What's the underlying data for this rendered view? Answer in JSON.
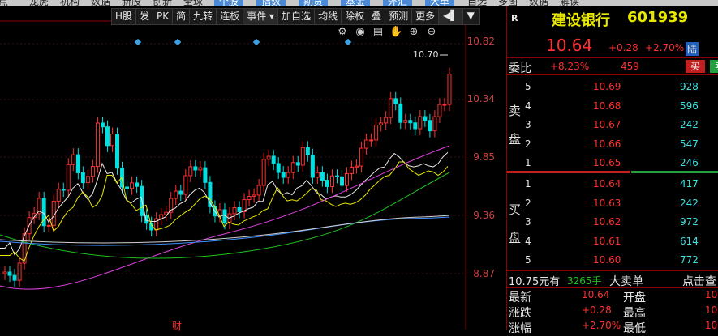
{
  "top_menu": [
    {
      "label": "点"
    },
    {
      "label": "龙虎"
    },
    {
      "label": "机构"
    },
    {
      "label": "数据"
    },
    {
      "label": "新股"
    },
    {
      "label": "创新"
    },
    {
      "label": "全球"
    },
    {
      "label": "个股",
      "highlight": true
    },
    {
      "label": "指数",
      "highlight": true
    },
    {
      "label": "期货",
      "highlight": true
    },
    {
      "label": "基金",
      "highlight": true
    },
    {
      "label": "外汇",
      "highlight": true
    },
    {
      "label": "大单",
      "highlight": true
    },
    {
      "label": "自选"
    },
    {
      "label": "多图"
    },
    {
      "label": "数据"
    },
    {
      "label": "解读"
    }
  ],
  "toolbar": [
    "H股",
    "发",
    "PK",
    "简",
    "九转",
    "连板",
    "事件 ▾",
    "加自选",
    "均线",
    "除权",
    "叠",
    "预测",
    "更多",
    "◀▌",
    "▼"
  ],
  "chart_icons": [
    "settings-icon",
    "eye-icon",
    "layers-icon",
    "hand-icon",
    "zoom-in-icon",
    "zoom-out-icon"
  ],
  "price_axis": [
    "10.82",
    "10.34",
    "9.85",
    "9.36",
    "8.87"
  ],
  "high_marker": "10.70",
  "bottom_marker": "财",
  "quote": {
    "label": "R",
    "name": "建设银行",
    "code": "601939",
    "price": "10.64",
    "change": "+0.28",
    "pct": "+2.70%",
    "market": "陆"
  },
  "weibi": {
    "label": "委比",
    "pct": "+8.23%",
    "value": "459",
    "sell_btn": "买",
    "buy_btn": "卖"
  },
  "sell_label": [
    "卖",
    "盘"
  ],
  "buy_label": [
    "买",
    "盘"
  ],
  "sell_levels": [
    {
      "level": "5",
      "price": "10.69",
      "vol": "928"
    },
    {
      "level": "4",
      "price": "10.68",
      "vol": "596"
    },
    {
      "level": "3",
      "price": "10.67",
      "vol": "242"
    },
    {
      "level": "2",
      "price": "10.66",
      "vol": "547"
    },
    {
      "level": "1",
      "price": "10.65",
      "vol": "246"
    }
  ],
  "buy_levels": [
    {
      "level": "1",
      "price": "10.64",
      "vol": "417"
    },
    {
      "level": "2",
      "price": "10.63",
      "vol": "242"
    },
    {
      "level": "3",
      "price": "10.62",
      "vol": "972"
    },
    {
      "level": "4",
      "price": "10.61",
      "vol": "614"
    },
    {
      "level": "5",
      "price": "10.60",
      "vol": "772"
    }
  ],
  "big_order": {
    "amount": "10.75元有",
    "vol": "3265手",
    "label": "大卖单",
    "action": "点击查"
  },
  "stats": [
    {
      "k1": "最新",
      "v1": "10.64",
      "k2": "开盘",
      "v2": "10"
    },
    {
      "k1": "涨跌",
      "v1": "+0.28",
      "k2": "最高",
      "v2": "10"
    },
    {
      "k1": "涨幅",
      "v1": "+2.70%",
      "k2": "最低",
      "v2": "10"
    }
  ],
  "colors": {
    "up": "#ff3030",
    "down": "#00e0e0",
    "ma5": "#e8e8e8",
    "ma10": "#e8e800",
    "ma20": "#e040e0",
    "ma60": "#20c020",
    "ma120": "#4090ff"
  }
}
